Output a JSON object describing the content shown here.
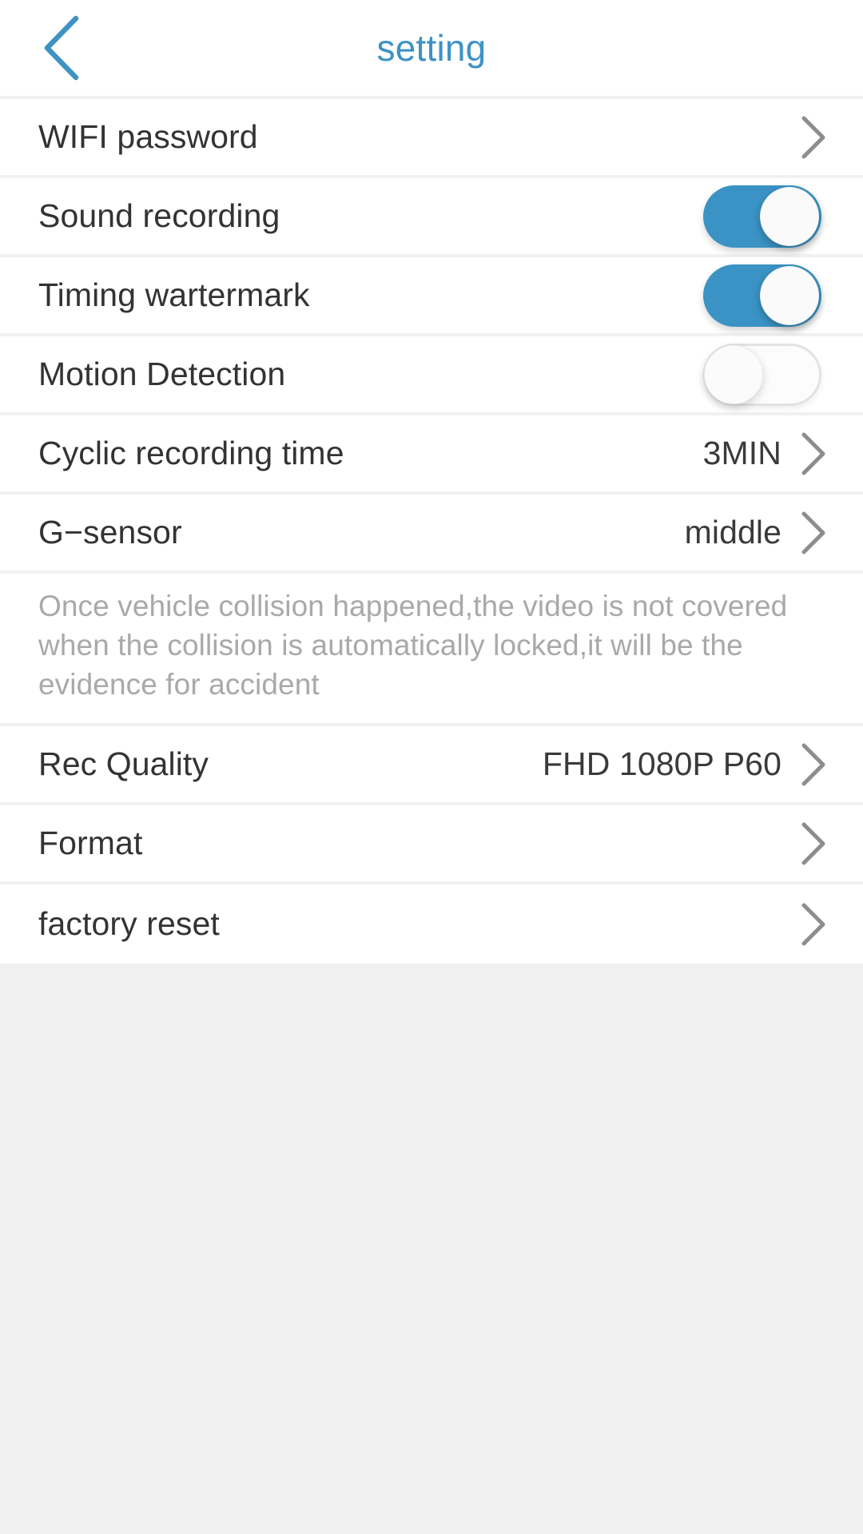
{
  "header": {
    "title": "setting",
    "back_icon": "chevron-left-icon",
    "accent_color": "#3e92c4"
  },
  "colors": {
    "toggle_on": "#3a93c4",
    "toggle_off_track": "#fcfcfc",
    "divider": "#f1f1f1",
    "page_background": "#f0f0f0",
    "row_background": "#ffffff",
    "label_text": "#333333",
    "value_text": "#3a3a3a",
    "description_text": "#a9a9a9",
    "chevron": "#8d8d8d"
  },
  "rows": [
    {
      "id": "wifi-password",
      "label": "WIFI password",
      "type": "navigation",
      "value": "",
      "chevron_icon": "chevron-right-icon"
    },
    {
      "id": "sound-recording",
      "label": "Sound recording",
      "type": "toggle",
      "toggle_state": "on"
    },
    {
      "id": "timing-watermark",
      "label": "Timing wartermark",
      "type": "toggle",
      "toggle_state": "on"
    },
    {
      "id": "motion-detection",
      "label": "Motion Detection",
      "type": "toggle",
      "toggle_state": "off"
    },
    {
      "id": "cyclic-recording-time",
      "label": "Cyclic recording time",
      "type": "navigation",
      "value": "3MIN",
      "chevron_icon": "chevron-right-icon"
    },
    {
      "id": "g-sensor",
      "label": "G−sensor",
      "type": "navigation",
      "value": "middle",
      "chevron_icon": "chevron-right-icon"
    }
  ],
  "description": {
    "text": "Once vehicle collision happened,the video is not covered when the collision is automatically locked,it will be the evidence for accident"
  },
  "rows_after_description": [
    {
      "id": "rec-quality",
      "label": "Rec Quality",
      "type": "navigation",
      "value": "FHD 1080P P60",
      "chevron_icon": "chevron-right-icon"
    },
    {
      "id": "format",
      "label": "Format",
      "type": "navigation",
      "value": "",
      "chevron_icon": "chevron-right-icon"
    },
    {
      "id": "factory-reset",
      "label": "factory reset",
      "type": "navigation",
      "value": "",
      "chevron_icon": "chevron-right-icon"
    }
  ]
}
